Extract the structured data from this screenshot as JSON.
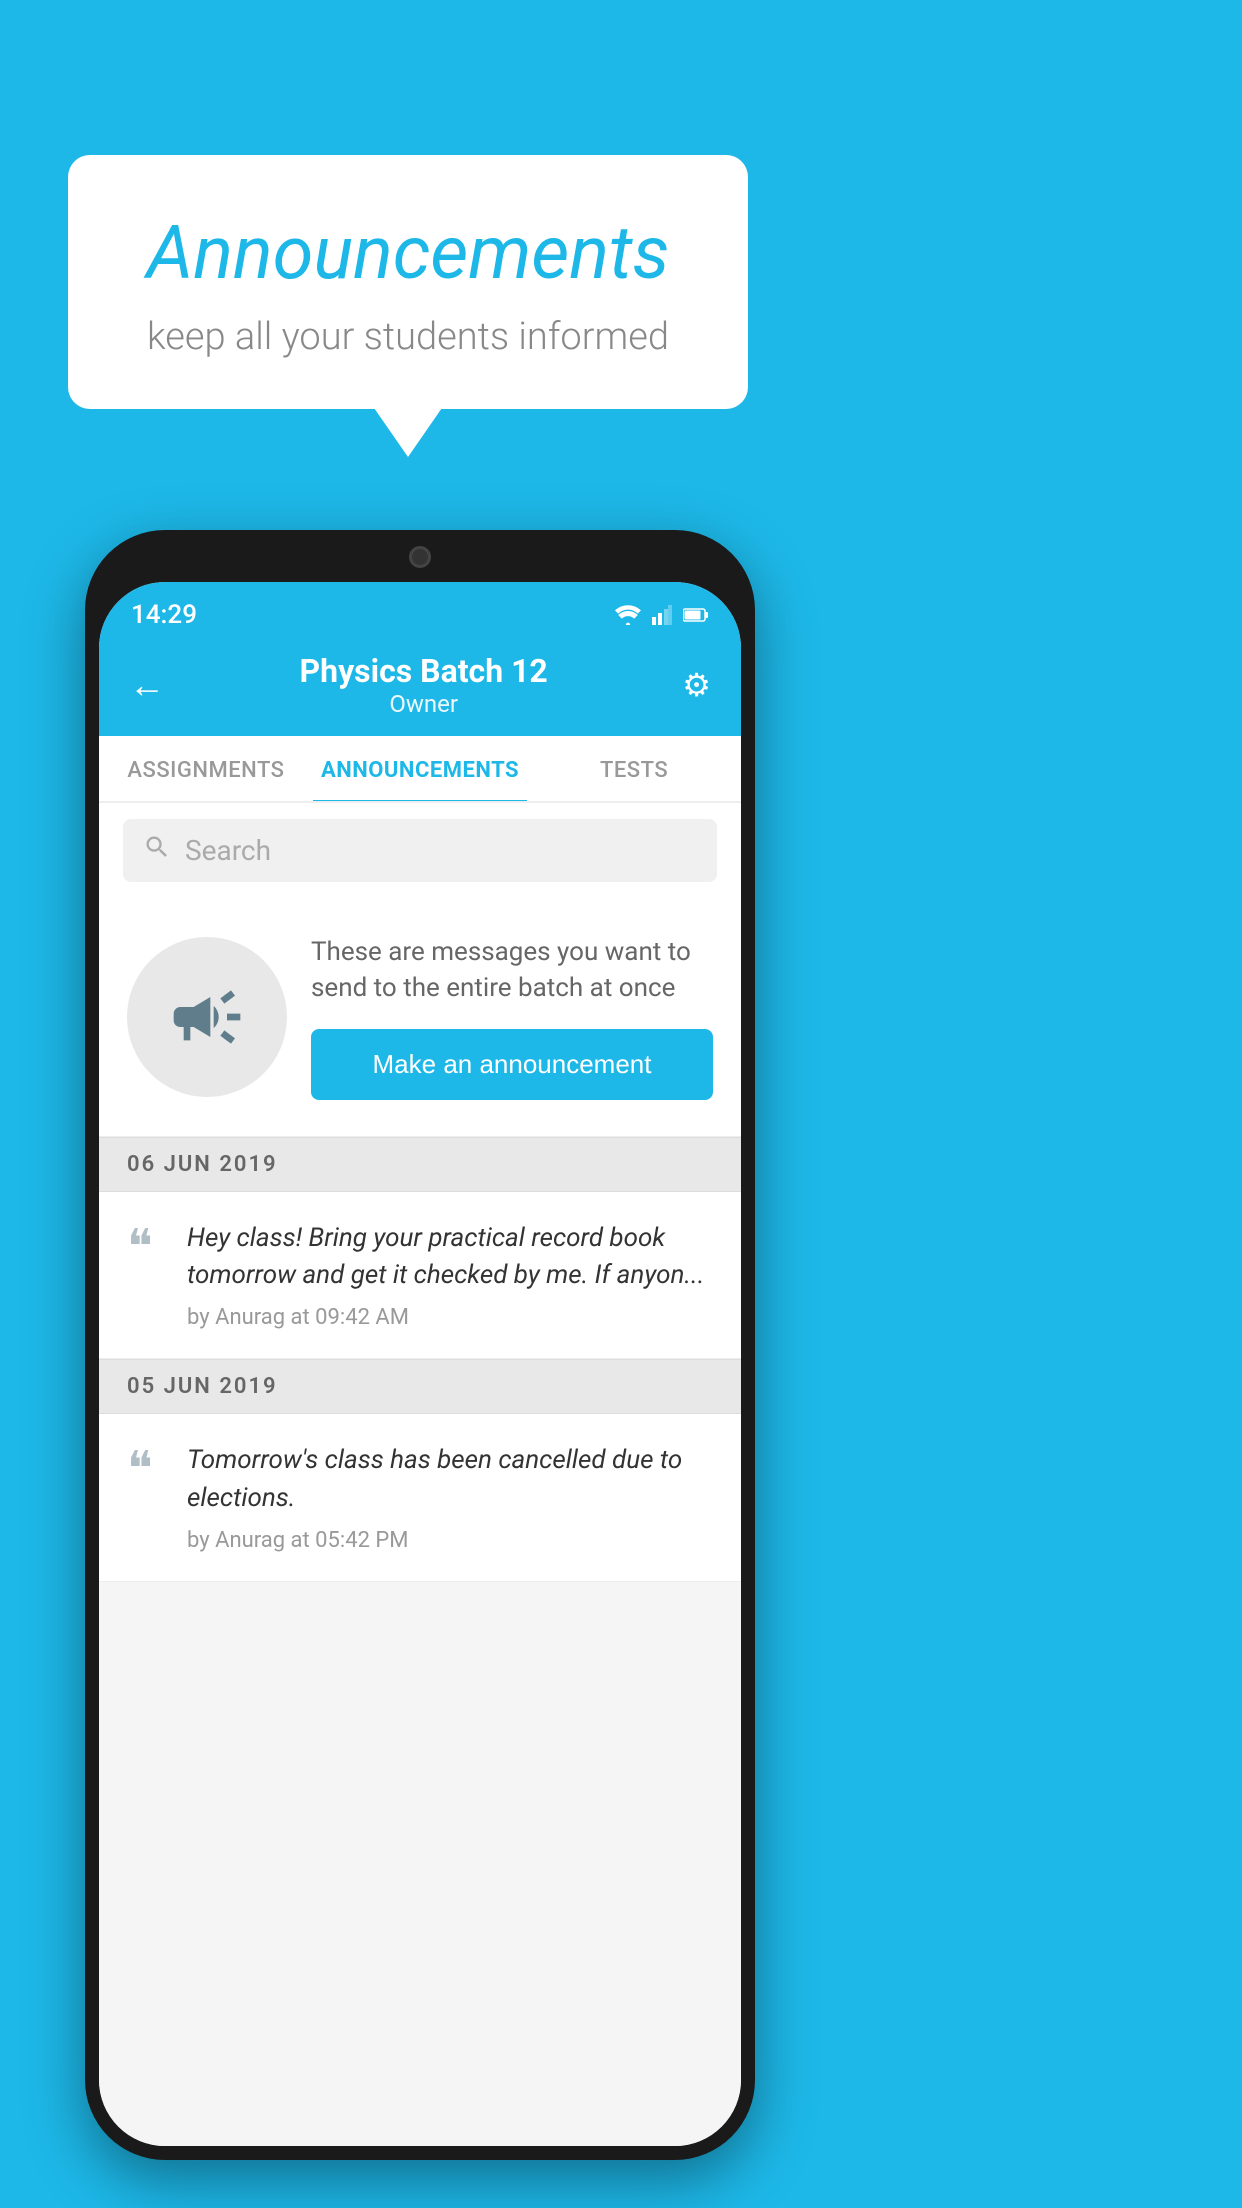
{
  "background_color": "#1db8e8",
  "speech_bubble": {
    "title": "Announcements",
    "subtitle": "keep all your students informed"
  },
  "phone": {
    "status_bar": {
      "time": "14:29"
    },
    "header": {
      "title": "Physics Batch 12",
      "subtitle": "Owner",
      "back_label": "←",
      "gear_label": "⚙"
    },
    "tabs": [
      {
        "label": "ASSIGNMENTS",
        "active": false
      },
      {
        "label": "ANNOUNCEMENTS",
        "active": true
      },
      {
        "label": "TESTS",
        "active": false
      }
    ],
    "search": {
      "placeholder": "Search"
    },
    "promo": {
      "description": "These are messages you want to send to the entire batch at once",
      "button_label": "Make an announcement"
    },
    "announcements": [
      {
        "date": "06  JUN  2019",
        "text": "Hey class! Bring your practical record book tomorrow and get it checked by me. If anyon...",
        "meta": "by Anurag at 09:42 AM"
      },
      {
        "date": "05  JUN  2019",
        "text": "Tomorrow's class has been cancelled due to elections.",
        "meta": "by Anurag at 05:42 PM"
      }
    ]
  }
}
